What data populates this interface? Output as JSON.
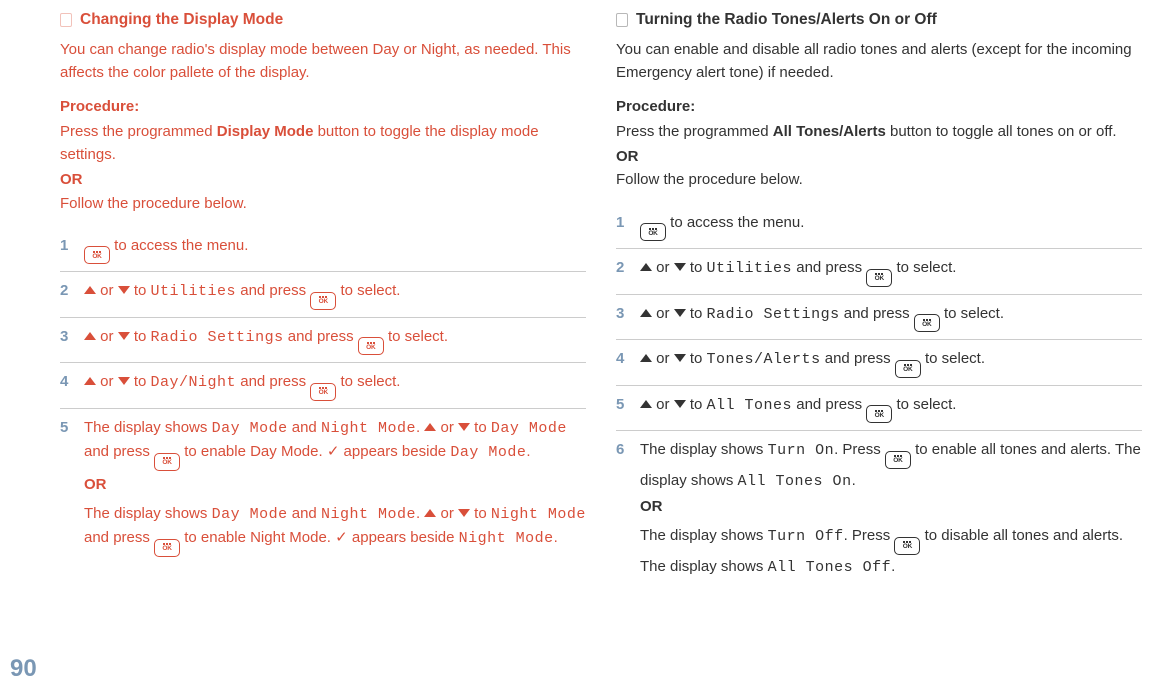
{
  "left": {
    "heading": "Changing the Display Mode",
    "intro": "You can change radio's display mode between Day or Night, as needed. This affects the color pallete of the display.",
    "procedureLabel": "Procedure:",
    "procText1": "Press the programmed ",
    "procBold": "Display Mode",
    "procText2": " button to toggle the display mode settings.",
    "or": "OR",
    "procText3": "Follow the procedure below.",
    "steps": {
      "s1": {
        "num": "1",
        "a": " to access the menu."
      },
      "s2": {
        "num": "2",
        "a": " or ",
        "b": " to ",
        "m1": "Utilities",
        "c": " and press ",
        "d": " to select."
      },
      "s3": {
        "num": "3",
        "a": " or ",
        "b": " to ",
        "m1": "Radio Settings",
        "c": " and press ",
        "d": " to select."
      },
      "s4": {
        "num": "4",
        "a": " or ",
        "b": " to ",
        "m1": "Day/Night",
        "c": " and press ",
        "d": " to select."
      },
      "s5": {
        "num": "5",
        "p1a": "The display shows ",
        "m1": "Day Mode",
        "p1b": " and ",
        "m2": "Night Mode",
        "p1c": ". ",
        "p2a": " or ",
        "p2b": " to ",
        "m3": "Day Mode",
        "p2c": " and press ",
        "p2d": " to enable Day Mode.  ",
        "check": "✓",
        "p2e": " appears beside ",
        "m4": "Day Mode",
        "p2f": ".",
        "or": "OR",
        "p3a": "The display shows ",
        "m5": "Day Mode",
        "p3b": " and ",
        "m6": "Night Mode",
        "p3c": ". ",
        "p4a": " or ",
        "p4b": " to ",
        "m7": "Night Mode",
        "p4c": " and press ",
        "p4d": " to enable Night Mode. ",
        "check2": "✓",
        "p4e": " appears beside ",
        "m8": "Night Mode",
        "p4f": "."
      }
    }
  },
  "right": {
    "heading": "Turning the Radio Tones/Alerts On or Off",
    "intro": "You can enable and disable all radio tones and alerts (except for the incoming Emergency alert tone) if needed.",
    "procedureLabel": "Procedure:",
    "procText1": "Press the programmed ",
    "procBold": "All Tones/Alerts",
    "procText2": " button to toggle all tones on or off.",
    "or": "OR",
    "procText3": "Follow the procedure below.",
    "steps": {
      "s1": {
        "num": "1",
        "a": " to access the menu."
      },
      "s2": {
        "num": "2",
        "a": " or ",
        "b": " to ",
        "m1": "Utilities",
        "c": " and press ",
        "d": " to select."
      },
      "s3": {
        "num": "3",
        "a": " or ",
        "b": " to ",
        "m1": "Radio Settings",
        "c": " and press ",
        "d": " to select."
      },
      "s4": {
        "num": "4",
        "a": " or ",
        "b": " to ",
        "m1": "Tones/Alerts",
        "c": " and press ",
        "d": " to select."
      },
      "s5": {
        "num": "5",
        "a": " or ",
        "b": " to ",
        "m1": "All Tones",
        "c": " and press ",
        "d": " to select."
      },
      "s6": {
        "num": "6",
        "p1a": "The display shows ",
        "m1": "Turn On",
        "p1b": ". Press ",
        "p1c": " to enable all tones and alerts. The display shows ",
        "m2": "All Tones On",
        "p1d": ".",
        "or": "OR",
        "p2a": "The display shows ",
        "m3": "Turn Off",
        "p2b": ". Press ",
        "p2c": " to disable all tones and alerts. The display shows ",
        "m4": "All Tones Off",
        "p2d": "."
      }
    }
  },
  "pageNumber": "90"
}
